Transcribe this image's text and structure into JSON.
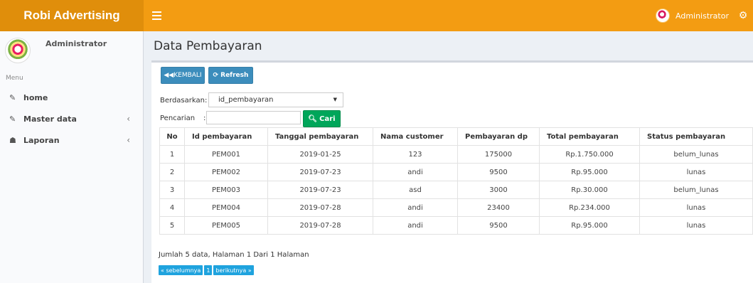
{
  "app": {
    "brand": "Robi Advertising"
  },
  "header": {
    "user_name": "Administrator",
    "settings_icon": "gears-icon",
    "menu_icon": "hamburger-icon"
  },
  "sidebar": {
    "user_name": "Administrator",
    "menu_header": "Menu",
    "items": [
      {
        "label": "home",
        "icon": "edit-icon"
      },
      {
        "label": "Master data",
        "icon": "edit-icon",
        "chevron": "‹"
      },
      {
        "label": "Laporan",
        "icon": "sitemap-icon",
        "chevron": "‹"
      }
    ]
  },
  "page": {
    "title": "Data Pembayaran"
  },
  "toolbar": {
    "back_label": "KEMBALI",
    "refresh_label": "Refresh"
  },
  "filter": {
    "based_label": "Berdasarkan:",
    "based_value": "id_pembayaran",
    "search_label": "Pencarian",
    "colon": ":",
    "search_value": "",
    "search_button": "Cari"
  },
  "table": {
    "headers": [
      "No",
      "Id pembayaran",
      "Tanggal pembayaran",
      "Nama customer",
      "Pembayaran dp",
      "Total pembayaran",
      "Status pembayaran"
    ],
    "rows": [
      [
        "1",
        "PEM001",
        "2019-01-25",
        "123",
        "175000",
        "Rp.1.750.000",
        "belum_lunas"
      ],
      [
        "2",
        "PEM002",
        "2019-07-23",
        "andi",
        "9500",
        "Rp.95.000",
        "lunas"
      ],
      [
        "3",
        "PEM003",
        "2019-07-23",
        "asd",
        "3000",
        "Rp.30.000",
        "belum_lunas"
      ],
      [
        "4",
        "PEM004",
        "2019-07-28",
        "andi",
        "23400",
        "Rp.234.000",
        "lunas"
      ],
      [
        "5",
        "PEM005",
        "2019-07-28",
        "andi",
        "9500",
        "Rp.95.000",
        "lunas"
      ]
    ]
  },
  "summary": "Jumlah 5 data, Halaman 1 Dari 1 Halaman",
  "pagination": {
    "prev": "« sebelumnya",
    "current": "1",
    "next": "berikutnya »"
  },
  "colors": {
    "brand": "#e08e0b",
    "topbar": "#f39c12",
    "primary": "#3c8dbc",
    "success": "#00a65a",
    "pager": "#1fa3de"
  }
}
